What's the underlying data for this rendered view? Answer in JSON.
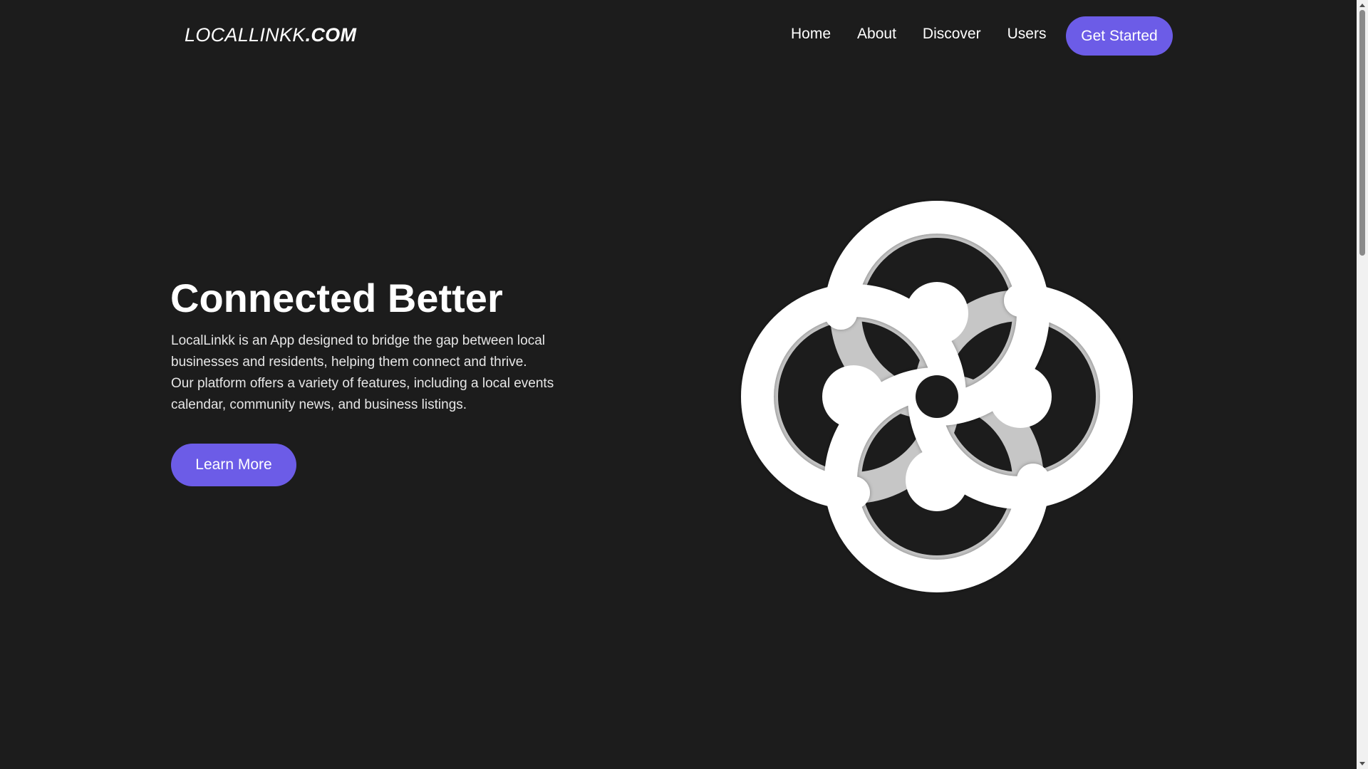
{
  "header": {
    "logo_main": "LOCALLINKK",
    "logo_suffix": ".COM",
    "nav": {
      "home": "Home",
      "about": "About",
      "discover": "Discover",
      "users": "Users"
    },
    "cta_label": "Get Started"
  },
  "hero": {
    "title": "Connected Better",
    "paragraph_line1": "LocalLinkk is an App designed to bridge the gap between local businesses and residents, helping them connect and thrive.",
    "paragraph_line2": "Our platform offers a variety of features, including a local events calendar, community news, and business listings.",
    "button_label": "Learn More",
    "graphic_icon": "interlinked-loops-logo-icon"
  },
  "colors": {
    "background": "#1c1c1c",
    "accent": "#6c5ce7",
    "text": "#ffffff"
  }
}
